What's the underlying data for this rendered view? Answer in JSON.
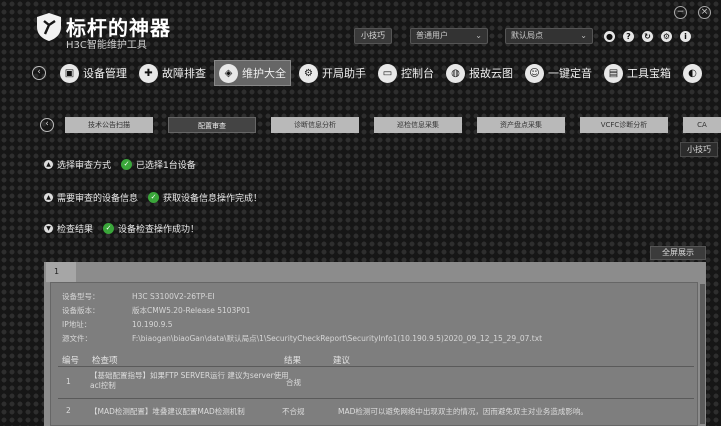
{
  "app": {
    "title": "标杆的神器",
    "subtitle": "H3C智能维护工具"
  },
  "topbar": {
    "tips_label": "小技巧",
    "user_select": "普通用户",
    "site_select": "默认局点"
  },
  "menu": [
    {
      "label": "设备管理",
      "icon": "device-icon"
    },
    {
      "label": "故障排查",
      "icon": "troubleshoot-icon"
    },
    {
      "label": "维护大全",
      "icon": "shield-icon",
      "active": true
    },
    {
      "label": "开局助手",
      "icon": "gear-icon"
    },
    {
      "label": "控制台",
      "icon": "console-icon"
    },
    {
      "label": "报故云图",
      "icon": "globe-icon"
    },
    {
      "label": "一键定音",
      "icon": "person-icon"
    },
    {
      "label": "工具宝箱",
      "icon": "toolbox-icon"
    }
  ],
  "tabs": [
    "技术公告扫描",
    "配置审查",
    "诊断信息分析",
    "巡检信息采集",
    "资产盘点采集",
    "VCFC诊断分析",
    "CA"
  ],
  "tips_popup": "小技巧",
  "steps": [
    {
      "label": "选择审查方式",
      "status": "已选择1台设备"
    },
    {
      "label": "需要审查的设备信息",
      "status": "获取设备信息操作完成！"
    },
    {
      "label": "检查结果",
      "status": "设备检查操作成功！"
    }
  ],
  "full_button": "全屏展示",
  "result_tab": "1",
  "device_info": [
    {
      "k": "设备型号：",
      "v": "H3C S3100V2-26TP-EI"
    },
    {
      "k": "设备版本：",
      "v": "版本CMW5.20-Release 5103P01"
    },
    {
      "k": "IP地址：",
      "v": "10.190.9.5"
    },
    {
      "k": "源文件：",
      "v": "F:\\biaogan\\biaoGan\\data\\默认局点\\1\\SecurityCheckReport\\SecurityInfo1(10.190.9.5)2020_09_12_15_29_07.txt"
    }
  ],
  "table": {
    "headers": [
      "编号",
      "检查项",
      "结果",
      "建议"
    ],
    "rows": [
      {
        "no": "1",
        "item": "【基础配置指导】如果FTP SERVER运行 建议为server使用acl控制",
        "result": "合规",
        "advice": ""
      },
      {
        "no": "2",
        "item": "【MAD检测配置】堆叠建议配置MAD检测机制",
        "result": "不合规",
        "advice": "MAD检测可以避免网络中出现双主的情况，因而避免双主对业务造成影响。"
      }
    ]
  }
}
